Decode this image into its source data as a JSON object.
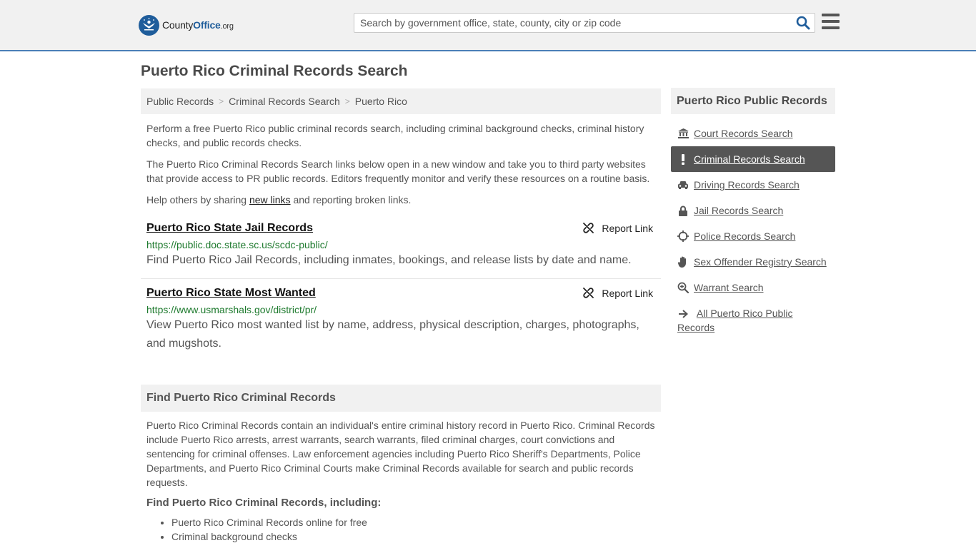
{
  "header": {
    "logo_main": "County",
    "logo_bold": "Office",
    "logo_suffix": ".org",
    "search_placeholder": "Search by government office, state, county, city or zip code"
  },
  "page": {
    "title": "Puerto Rico Criminal Records Search"
  },
  "breadcrumb": [
    "Public Records",
    "Criminal Records Search",
    "Puerto Rico"
  ],
  "intro": {
    "p1": "Perform a free Puerto Rico public criminal records search, including criminal background checks, criminal history checks, and public records checks.",
    "p2": "The Puerto Rico Criminal Records Search links below open in a new window and take you to third party websites that provide access to PR public records. Editors frequently monitor and verify these resources on a routine basis.",
    "p3_before": "Help others by sharing ",
    "p3_link": "new links",
    "p3_after": " and reporting broken links."
  },
  "results": [
    {
      "title": "Puerto Rico State Jail Records",
      "url": "https://public.doc.state.sc.us/scdc-public/",
      "description": "Find Puerto Rico Jail Records, including inmates, bookings, and release lists by date and name.",
      "report_label": "Report Link"
    },
    {
      "title": "Puerto Rico State Most Wanted",
      "url": "https://www.usmarshals.gov/district/pr/",
      "description": "View Puerto Rico most wanted list by name, address, physical description, charges, photographs, and mugshots.",
      "report_label": "Report Link"
    }
  ],
  "find_section": {
    "heading": "Find Puerto Rico Criminal Records",
    "body": "Puerto Rico Criminal Records contain an individual's entire criminal history record in Puerto Rico. Criminal Records include Puerto Rico arrests, arrest warrants, search warrants, filed criminal charges, court convictions and sentencing for criminal offenses. Law enforcement agencies including Puerto Rico Sheriff's Departments, Police Departments, and Puerto Rico Criminal Courts make Criminal Records available for search and public records requests.",
    "subheading": "Find Puerto Rico Criminal Records, including:",
    "bullets": [
      "Puerto Rico Criminal Records online for free",
      "Criminal background checks"
    ]
  },
  "sidebar": {
    "heading": "Puerto Rico Public Records",
    "items": [
      {
        "label": "Court Records Search",
        "icon": "courthouse-icon"
      },
      {
        "label": "Criminal Records Search",
        "icon": "exclamation-icon",
        "active": true
      },
      {
        "label": "Driving Records Search",
        "icon": "car-icon"
      },
      {
        "label": "Jail Records Search",
        "icon": "lock-icon"
      },
      {
        "label": "Police Records Search",
        "icon": "crosshair-icon"
      },
      {
        "label": "Sex Offender Registry Search",
        "icon": "hand-icon"
      },
      {
        "label": "Warrant Search",
        "icon": "magnifier-plus-icon"
      },
      {
        "label": "All Puerto Rico Public Records",
        "icon": "arrow-right-icon"
      }
    ]
  },
  "colors": {
    "brand_blue": "#1f5d9b",
    "url_green": "#1e7a2e",
    "active_bg": "#555555"
  }
}
